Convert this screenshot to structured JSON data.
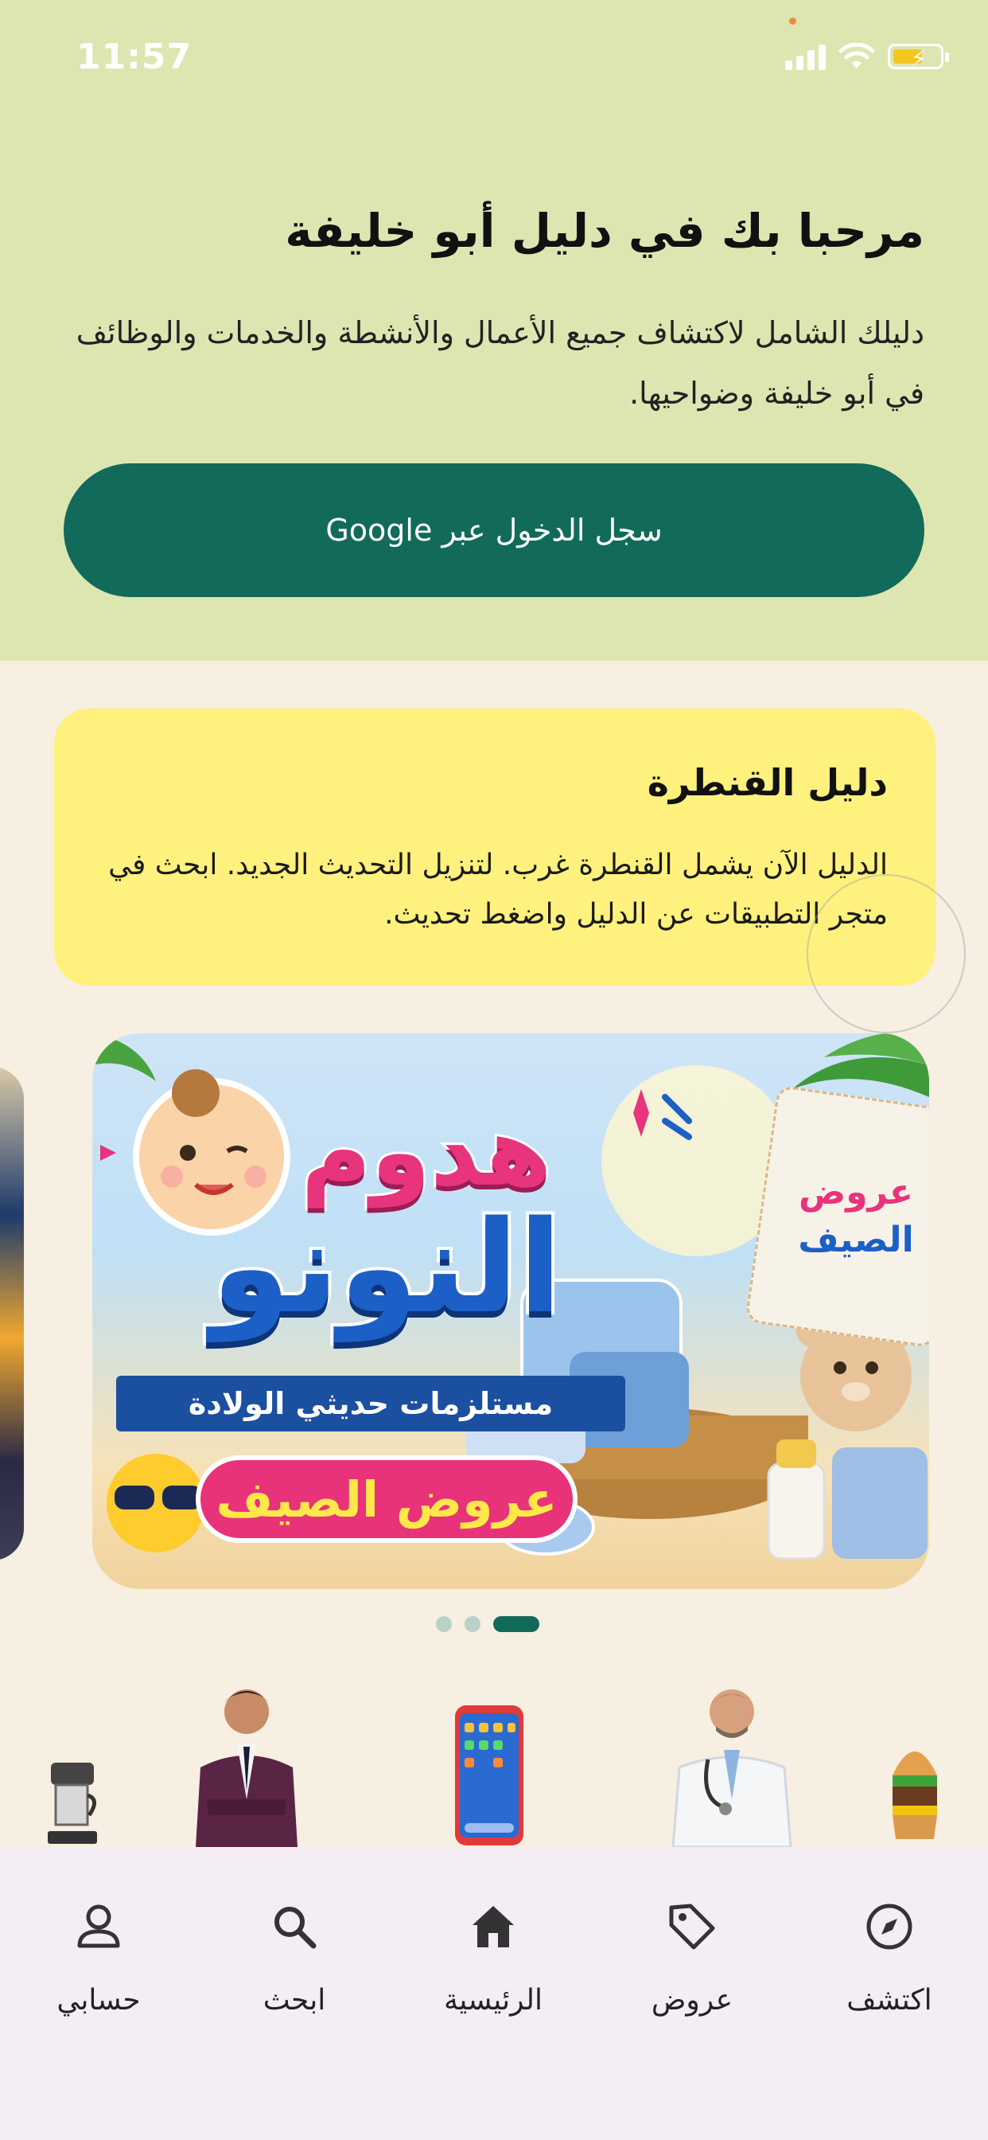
{
  "status_bar": {
    "time": "11:57"
  },
  "hero": {
    "title": "مرحبا بك في دليل أبو خليفة",
    "subtitle": "دليلك الشامل لاكتشاف جميع الأعمال والأنشطة والخدمات والوظائف في أبو خليفة وضواحيها.",
    "google_button": "سجل الدخول عبر Google"
  },
  "notice": {
    "title": "دليل القنطرة",
    "body": "الدليل الآن يشمل القنطرة غرب. لتنزيل التحديث الجديد. ابحث في متجر التطبيقات عن الدليل واضغط تحديث."
  },
  "banner": {
    "brand_line1": "هدوم",
    "brand_line2": "النونو",
    "ribbon": "مستلزمات حديثي الولادة",
    "promo": "عروض الصيف",
    "tag_line1": "عروض",
    "tag_line2": "الصيف",
    "carousel_count": 3,
    "carousel_active_index": 2
  },
  "categories": [
    {
      "icon": "coffee-machine-icon"
    },
    {
      "icon": "businessman-icon"
    },
    {
      "icon": "smartphone-icon"
    },
    {
      "icon": "doctor-icon"
    },
    {
      "icon": "burger-icon"
    }
  ],
  "bottom_nav": {
    "items": [
      {
        "label": "حسابي",
        "icon": "person-icon"
      },
      {
        "label": "ابحث",
        "icon": "search-icon"
      },
      {
        "label": "الرئيسية",
        "icon": "home-icon"
      },
      {
        "label": "عروض",
        "icon": "tag-icon"
      },
      {
        "label": "اكتشف",
        "icon": "compass-icon"
      }
    ]
  },
  "colors": {
    "hero_bg": "#dde6b1",
    "page_bg": "#f6efe2",
    "primary": "#126a5b",
    "notice_bg": "#fff17d",
    "nav_bg": "#f4edf6"
  }
}
